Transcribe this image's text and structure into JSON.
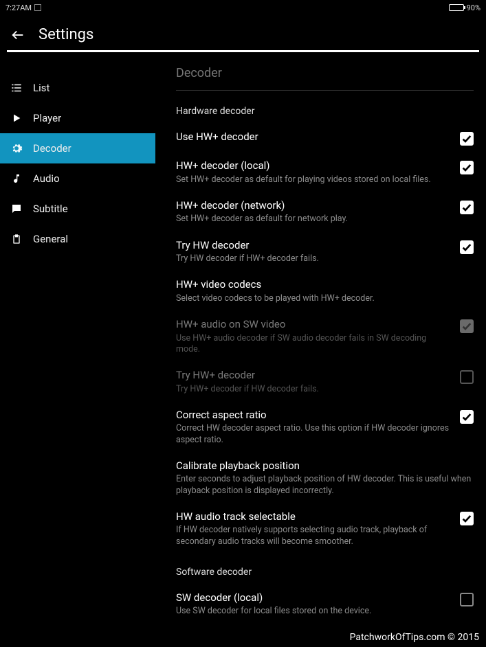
{
  "status": {
    "time": "7:27AM",
    "battery_pct": "90%"
  },
  "header": {
    "title": "Settings"
  },
  "sidebar": {
    "items": [
      {
        "label": "List"
      },
      {
        "label": "Player"
      },
      {
        "label": "Decoder"
      },
      {
        "label": "Audio"
      },
      {
        "label": "Subtitle"
      },
      {
        "label": "General"
      }
    ]
  },
  "content": {
    "section_title": "Decoder",
    "category_hw": "Hardware decoder",
    "category_sw": "Software decoder",
    "settings": {
      "use_hw_plus": {
        "title": "Use HW+ decoder"
      },
      "hw_plus_local": {
        "title": "HW+ decoder (local)",
        "sub": "Set HW+ decoder as default for playing videos stored on local files."
      },
      "hw_plus_network": {
        "title": "HW+ decoder (network)",
        "sub": "Set HW+ decoder as default for network play."
      },
      "try_hw": {
        "title": "Try HW decoder",
        "sub": "Try HW decoder if HW+ decoder fails."
      },
      "hw_codecs": {
        "title": "HW+ video codecs",
        "sub": "Select video codecs to be played with HW+ decoder."
      },
      "hw_audio_sw": {
        "title": "HW+ audio on SW video",
        "sub": "Use HW+ audio decoder if SW audio decoder fails in SW decoding mode."
      },
      "try_hw_plus": {
        "title": "Try HW+ decoder",
        "sub": "Try HW+ decoder if HW decoder fails."
      },
      "aspect": {
        "title": "Correct aspect ratio",
        "sub": "Correct HW decoder aspect ratio. Use this option if HW decoder ignores aspect ratio."
      },
      "calibrate": {
        "title": "Calibrate playback position",
        "sub": "Enter seconds to adjust playback position of HW decoder. This is useful when playback position is displayed incorrectly."
      },
      "hw_audio_track": {
        "title": "HW audio track selectable",
        "sub": "If HW decoder natively supports selecting audio track, playback of secondary audio tracks will become smoother."
      },
      "sw_local": {
        "title": "SW decoder (local)",
        "sub": "Use SW decoder for local files stored on the device."
      }
    }
  },
  "watermark": "PatchworkOfTips.com © 2015"
}
